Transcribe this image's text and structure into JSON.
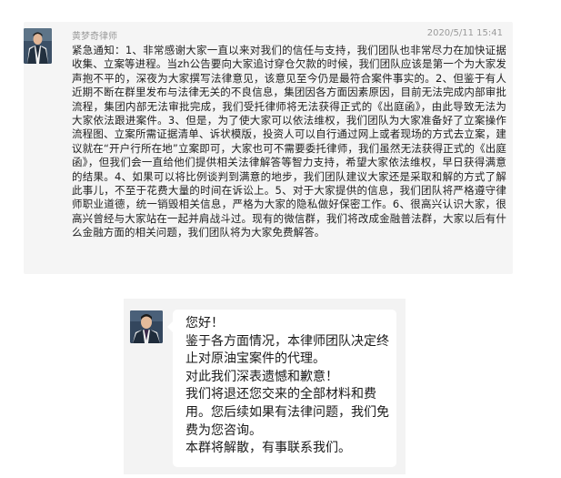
{
  "group_message": {
    "sender": "黄梦奇律师",
    "timestamp": "2020/5/11 15:41",
    "avatar_icon": "lawyer-portrait-icon",
    "text": "紧急通知：1、非常感谢大家一直以来对我们的信任与支持，我们团队也非常尽力在加快证据收集、立案等进程。当zh公告要向大家追讨穿仓欠款的时候，我们团队应该是第一个为大家发声抱不平的，深夜为大家撰写法律意见，该意见至今仍是最符合案件事实的。2、但鉴于有人近期不断在群里发布与法律无关的不良信息，集团因各方面因素原因，目前无法完成内部审批流程，集团内部无法审批完成，我们受托律师将无法获得正式的《出庭函》，由此导致无法为大家依法跟进案件。3、但是，为了使大家可以依法维权，我们团队为大家准备好了立案操作流程图、立案所需证据清单、诉状模版，投资人可以自行通过网上或者现场的方式去立案，建议就在“开户行所在地”立案即可，大家也可不需要委托律师，我们虽然无法获得正式的《出庭函》，但我们会一直给他们提供相关法律解答等智力支持，希望大家依法维权，早日获得满意的结果。4、如果可以将比例谈判到满意的地步，我们团队建议大家还是采取和解的方式了解此事儿，不至于花费大量的时间在诉讼上。5、对于大家提供的信息，我们团队将严格遵守律师职业道德，统一销毁相关信息，严格为大家的隐私做好保密工作。6、很高兴认识大家，很高兴曾经与大家站在一起并肩战斗过。现有的微信群，我们将改成金融普法群，大家以后有什么金融方面的相关问题，我们团队将为大家免费解答。"
  },
  "notice_message": {
    "avatar_icon": "lawyer-portrait-icon",
    "text": "您好！\n鉴于各方面情况，本律师团队决定终止对原油宝案件的代理。\n对此我们深表遗憾和歉意！\n我们将退还您交来的全部材料和费用。您后续如果有法律问题，我们免费为您咨询。\n本群将解散，有事联系我们。"
  },
  "colors": {
    "card_bg": "#f5f5f5",
    "bubble_bg": "#ffffff",
    "meta_text": "#9a9a9a",
    "body_text": "#1f1f1f"
  }
}
